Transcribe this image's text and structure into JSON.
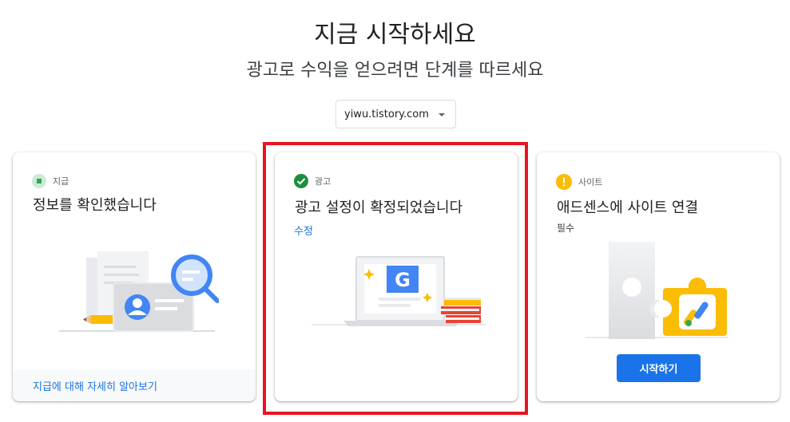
{
  "header": {
    "title": "지금 시작하세요",
    "subtitle": "광고로 수익을 얻으려면 단계를 따르세요"
  },
  "site_select": {
    "value": "yiwu.tistory.com"
  },
  "cards": [
    {
      "step_label": "지급",
      "status": "complete-square",
      "title": "정보를 확인했습니다",
      "footer_link": "지급에 대해 자세히 알아보기"
    },
    {
      "step_label": "광고",
      "status": "complete-check",
      "title": "광고 설정이 확정되었습니다",
      "edit_link": "수정"
    },
    {
      "step_label": "사이트",
      "status": "warning",
      "title": "애드센스에 사이트 연결",
      "required": "필수",
      "button": "시작하기"
    }
  ],
  "colors": {
    "accent": "#1a73e8",
    "success": "#1e8e3e",
    "success_light": "#34a853",
    "warning": "#fbbc04",
    "highlight": "#e8141f"
  },
  "icons": [
    "check-square-icon",
    "check-circle-icon",
    "warning-icon",
    "caret-down-icon"
  ]
}
